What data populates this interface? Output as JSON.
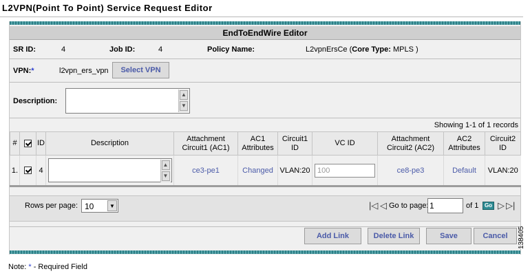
{
  "page_title": "L2VPN(Point To Point) Service Request Editor",
  "editor_title": "EndToEndWire Editor",
  "sr_id": {
    "label": "SR ID:",
    "value": "4"
  },
  "job_id": {
    "label": "Job ID:",
    "value": "4"
  },
  "policy": {
    "label": "Policy Name:",
    "name": "L2vpnErsCe",
    "core_label": "Core Type:",
    "core_value": "MPLS"
  },
  "vpn": {
    "label": "VPN:",
    "required_mark": "*",
    "value": "l2vpn_ers_vpn",
    "button": "Select VPN"
  },
  "description": {
    "label": "Description:",
    "value": ""
  },
  "showing": "Showing 1-1 of 1 records",
  "table": {
    "headers": {
      "num": "#",
      "id": "ID",
      "description": "Description",
      "ac1": "Attachment Circuit1 (AC1)",
      "ac1_attr": "AC1 Attributes",
      "circuit1_id": "Circuit1 ID",
      "vc_id": "VC ID",
      "ac2": "Attachment Circuit2 (AC2)",
      "ac2_attr": "AC2 Attributes",
      "circuit2_id": "Circuit2 ID"
    },
    "rows": [
      {
        "num": "1.",
        "checked": true,
        "id": "4",
        "description": "",
        "ac1": "ce3-pe1",
        "ac1_attr": "Changed",
        "circuit1_id": "VLAN:20",
        "vc_id": "100",
        "ac2": "ce8-pe3",
        "ac2_attr": "Default",
        "circuit2_id": "VLAN:20"
      }
    ]
  },
  "pager": {
    "rows_label": "Rows per page:",
    "rows_value": "10",
    "goto_label": "Go to page:",
    "goto_value": "1",
    "of_label": "of 1",
    "go": "Go"
  },
  "actions": {
    "add_link": "Add Link",
    "delete_link": "Delete Link",
    "save": "Save",
    "cancel": "Cancel"
  },
  "note": {
    "prefix": "Note:",
    "mark": "*",
    "text": "- Required Field"
  },
  "watermark": "138405",
  "colors": {
    "teal": "#2c7f86",
    "link": "#4a5aa8",
    "required": "#2c3fd0"
  }
}
